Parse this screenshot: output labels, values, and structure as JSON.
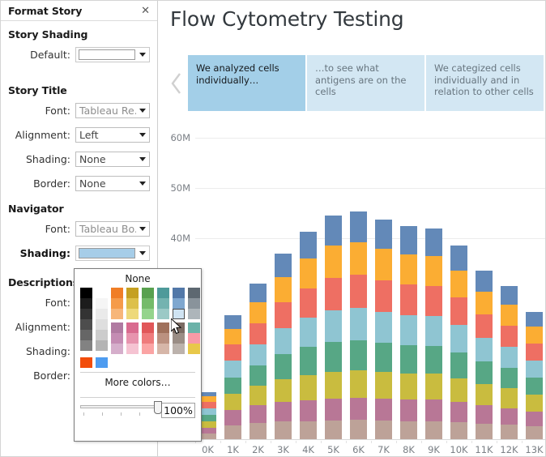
{
  "format_pane": {
    "title": "Format Story",
    "close_icon": "close-icon",
    "sections": [
      {
        "heading": "Story Shading",
        "rows": [
          {
            "label": "Default:",
            "type": "swatch",
            "value": "",
            "swatch_color": "#ffffff",
            "bold": false
          }
        ]
      },
      {
        "heading": "Story Title",
        "rows": [
          {
            "label": "Font:",
            "type": "text",
            "value": "Tableau Re..",
            "bold": false,
            "greyed": true
          },
          {
            "label": "Alignment:",
            "type": "text",
            "value": "Left",
            "bold": false,
            "greyed": false
          },
          {
            "label": "Shading:",
            "type": "text",
            "value": "None",
            "bold": false,
            "greyed": false
          },
          {
            "label": "Border:",
            "type": "text",
            "value": "None",
            "bold": false,
            "greyed": false
          }
        ]
      },
      {
        "heading": "Navigator",
        "rows": [
          {
            "label": "Font:",
            "type": "text",
            "value": "Tableau Bo..",
            "bold": false,
            "greyed": true
          },
          {
            "label": "Shading:",
            "type": "swatch",
            "value": "",
            "swatch_color": "#a6cde8",
            "bold": true
          }
        ]
      },
      {
        "heading": "Descriptions",
        "rows": [
          {
            "label": "Font:",
            "type": "hidden",
            "value": "",
            "bold": false
          },
          {
            "label": "Alignment:",
            "type": "hidden",
            "value": "",
            "bold": false
          },
          {
            "label": "Shading:",
            "type": "hidden",
            "value": "",
            "bold": false
          },
          {
            "label": "Border:",
            "type": "hidden",
            "value": "",
            "bold": false
          }
        ]
      }
    ]
  },
  "color_picker": {
    "none_label": "None",
    "more_colors_label": "More colors…",
    "opacity_value": "100%",
    "slider_position_pct": 100,
    "selected_swatch": "#cfe3f2",
    "columns": [
      {
        "name": "black-ramp",
        "swatches": [
          "#000000",
          "#1c1c1c",
          "#333333",
          "#4d4d4d",
          "#666666",
          "#828282"
        ]
      },
      {
        "name": "white-ramp",
        "swatches": [
          "#ffffff",
          "#f5f5f5",
          "#eaeaea",
          "#dedede",
          "#cccccc",
          "#b4b4b4"
        ]
      },
      {
        "name": "orange-ramp",
        "swatches": [
          "#f07e26",
          "#f59b4a",
          "#f7b679",
          "#b07aa1",
          "#c48cb3",
          "#d5aecb"
        ]
      },
      {
        "name": "gold-ramp",
        "swatches": [
          "#c5a021",
          "#ddc04a",
          "#eed97a",
          "#d96b8f",
          "#e794ae",
          "#f5c3d2"
        ]
      },
      {
        "name": "green-ramp",
        "swatches": [
          "#59a14f",
          "#75bb6a",
          "#94d48c",
          "#e15759",
          "#ef7b7c",
          "#fba4a4"
        ]
      },
      {
        "name": "teal-ramp",
        "swatches": [
          "#4e9a9a",
          "#74b3b0",
          "#9bc9c6",
          "#a0715c",
          "#bb9180",
          "#d6b6a8"
        ]
      },
      {
        "name": "blue-ramp",
        "swatches": [
          "#5278a8",
          "#7fa7cf",
          "#cfe3f2",
          "#7b6b63",
          "#9a8d85",
          "#bcb2ac"
        ]
      },
      {
        "name": "grey-blue-ramp",
        "swatches": [
          "#5d6871",
          "#89939b",
          "#adb5ba",
          "#6bb2a8",
          "#f79aa6",
          "#e8c84a"
        ]
      }
    ],
    "single_swatches": [
      "#f24d0b",
      "#4e9cf0"
    ]
  },
  "story": {
    "title": "Flow Cytometry Testing",
    "prev_icon": "chevron-left-icon",
    "cards": [
      {
        "text": "We analyzed cells individually…",
        "active": true
      },
      {
        "text": "…to see what antigens are on the cells",
        "active": false
      },
      {
        "text": "We categized cells individually and in relation to other cells",
        "active": false
      }
    ]
  },
  "chart_data": {
    "type": "bar",
    "stacked": true,
    "title": "",
    "xlabel": "",
    "ylabel": "",
    "ylim": [
      0,
      63
    ],
    "yticks": [
      40,
      50,
      60
    ],
    "ytick_labels": [
      "40M",
      "50M",
      "60M"
    ],
    "grid": true,
    "legend_position": "none",
    "categories": [
      "0K",
      "1K",
      "2K",
      "3K",
      "4K",
      "5K",
      "6K",
      "7K",
      "8K",
      "9K",
      "10K",
      "11K",
      "12K",
      "13K"
    ],
    "series": [
      {
        "name": "tan",
        "color": "#bda298",
        "values": [
          1.1,
          2.8,
          3.2,
          3.5,
          3.6,
          3.7,
          3.8,
          3.7,
          3.6,
          3.6,
          3.4,
          3.1,
          2.9,
          2.6
        ]
      },
      {
        "name": "mauve",
        "color": "#b87796",
        "values": [
          1.2,
          3.0,
          3.5,
          3.9,
          4.2,
          4.4,
          4.5,
          4.4,
          4.3,
          4.3,
          4.0,
          3.6,
          3.3,
          2.9
        ]
      },
      {
        "name": "olive",
        "color": "#c9bc3f",
        "values": [
          1.3,
          3.2,
          3.9,
          4.6,
          5.0,
          5.3,
          5.4,
          5.3,
          5.1,
          5.1,
          4.7,
          4.2,
          3.9,
          3.3
        ]
      },
      {
        "name": "green",
        "color": "#57a785",
        "values": [
          1.3,
          3.3,
          4.1,
          4.9,
          5.5,
          5.9,
          6.0,
          5.8,
          5.7,
          5.6,
          5.2,
          4.5,
          4.1,
          3.4
        ]
      },
      {
        "name": "light-blue",
        "color": "#8fc5d2",
        "values": [
          1.3,
          3.3,
          4.2,
          5.1,
          5.8,
          6.3,
          6.4,
          6.1,
          6.0,
          5.9,
          5.4,
          4.7,
          4.2,
          3.5
        ]
      },
      {
        "name": "red",
        "color": "#ee6f63",
        "values": [
          1.2,
          3.2,
          4.2,
          5.2,
          5.9,
          6.5,
          6.6,
          6.3,
          6.1,
          6.0,
          5.5,
          4.7,
          4.2,
          3.4
        ]
      },
      {
        "name": "orange",
        "color": "#fbad33",
        "values": [
          1.1,
          3.1,
          4.1,
          5.1,
          5.9,
          6.4,
          6.5,
          6.2,
          6.0,
          5.9,
          5.4,
          4.6,
          4.1,
          3.3
        ]
      },
      {
        "name": "blue",
        "color": "#6389b8",
        "values": [
          0.9,
          2.7,
          3.7,
          4.6,
          5.4,
          6.0,
          6.1,
          5.8,
          5.6,
          5.5,
          5.0,
          4.2,
          3.7,
          2.9
        ]
      }
    ],
    "totals": [
      9.4,
      24.6,
      30.9,
      36.9,
      41.3,
      44.5,
      45.3,
      43.6,
      42.4,
      41.9,
      38.6,
      33.6,
      30.4,
      25.3
    ]
  }
}
